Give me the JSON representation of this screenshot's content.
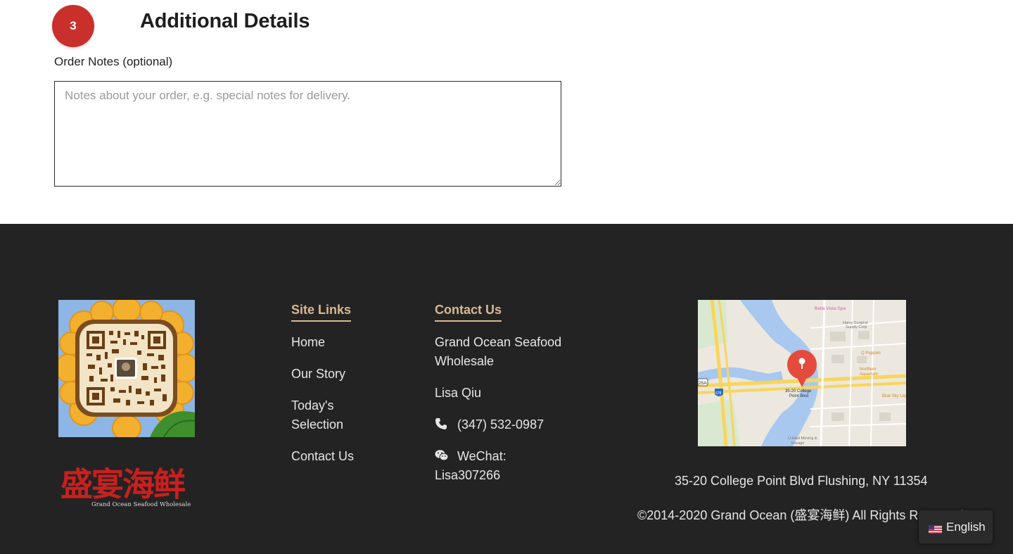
{
  "step": {
    "number": "3",
    "title": "Additional Details"
  },
  "order_notes": {
    "label": "Order Notes (optional)",
    "placeholder": "Notes about your order, e.g. special notes for delivery.",
    "value": ""
  },
  "footer": {
    "logo": {
      "chinese": "盛宴海鲜",
      "english": "Grand Ocean Seafood Wholesale"
    },
    "site_links": {
      "heading": "Site Links",
      "items": [
        "Home",
        "Our Story",
        "Today's",
        "Selection",
        "Contact Us"
      ]
    },
    "contact": {
      "heading": "Contact Us",
      "company_line1": "Grand Ocean Seafood",
      "company_line2": "Wholesale",
      "person": "Lisa Qiu",
      "phone": "(347) 532-0987",
      "wechat_label": "WeChat:",
      "wechat_id": "Lisa307266"
    },
    "map": {
      "pin_label": "35-20 College Point Blvd",
      "places": [
        "Bella Vista Spa",
        "Harvy Surgical Supply Corp",
        "Q Puppies",
        "Northern Aquarium",
        "Blue Sky Liqu",
        "U-Haul Moving & Storage",
        "678",
        "25A"
      ]
    },
    "address": "35-20 College Point Blvd Flushing, NY 11354",
    "copyright": "©2014-2020 Grand Ocean (盛宴海鲜) All Rights Reserved"
  },
  "language_switcher": {
    "label": "English",
    "flag": "us-flag-icon"
  },
  "colors": {
    "badge": "#c9302c",
    "footer_bg": "#232323",
    "heading_accent": "#d9b892"
  }
}
